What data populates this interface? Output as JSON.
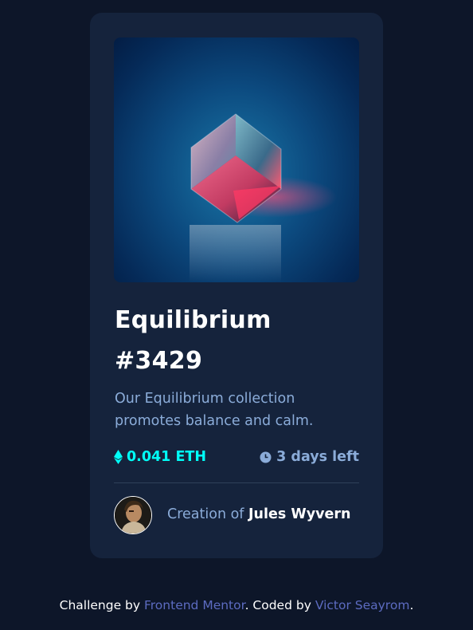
{
  "card": {
    "title": "Equilibrium #3429",
    "description": "Our Equilibrium collection promotes balance and calm.",
    "price": "0.041 ETH",
    "time_left": "3 days left",
    "creator_prefix": "Creation of ",
    "creator_name": "Jules Wyvern"
  },
  "footer": {
    "prefix": "Challenge by ",
    "link1": "Frontend Mentor",
    "middle": ". Coded by ",
    "link2": "Victor Seayrom",
    "suffix": "."
  },
  "icons": {
    "price": "ethereum-icon",
    "time": "clock-icon"
  },
  "colors": {
    "background": "#0d1629",
    "card": "#15233c",
    "cyan": "#00fff8",
    "soft_blue": "#8bacd9",
    "link": "#5c6bc0"
  }
}
